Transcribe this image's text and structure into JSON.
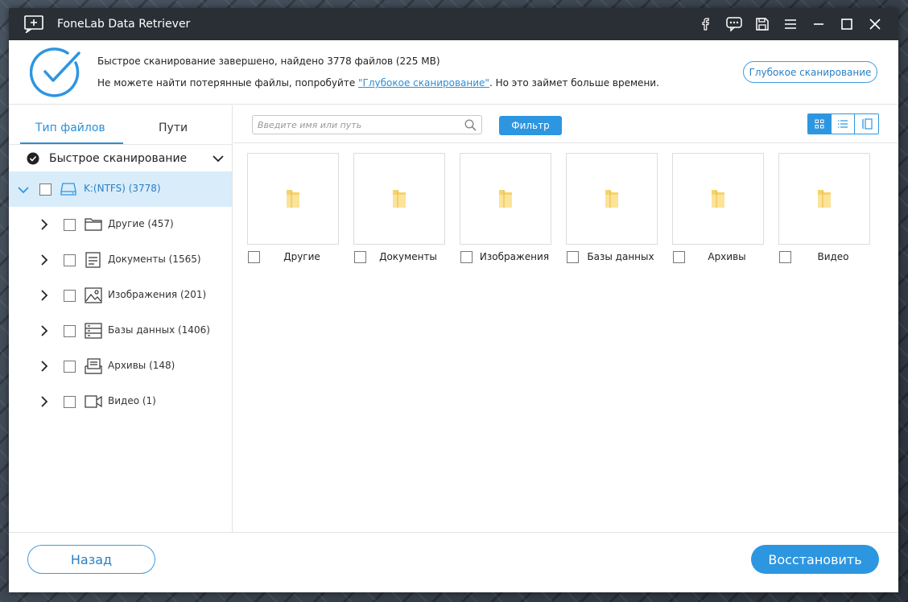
{
  "window": {
    "title": "FoneLab Data Retriever"
  },
  "status": {
    "line1": "Быстрое сканирование завершено, найдено 3778 файлов (225 MB)",
    "line2_prefix": "Не можете найти потерянные файлы, попробуйте ",
    "line2_link": "\"Глубокое сканирование\"",
    "line2_suffix": ". Но это займет больше времени.",
    "deep_scan_button": "Глубокое сканирование"
  },
  "sidebar": {
    "tabs": [
      {
        "label": "Тип файлов",
        "active": true
      },
      {
        "label": "Пути",
        "active": false
      }
    ],
    "scan_mode": "Быстрое сканирование",
    "drive": "K:(NTFS) (3778)",
    "items": [
      {
        "label": "Другие (457)",
        "icon": "folder-icon"
      },
      {
        "label": "Документы (1565)",
        "icon": "document-icon"
      },
      {
        "label": "Изображения (201)",
        "icon": "image-icon"
      },
      {
        "label": "Базы данных (1406)",
        "icon": "database-icon"
      },
      {
        "label": "Архивы (148)",
        "icon": "archive-icon"
      },
      {
        "label": "Видео (1)",
        "icon": "video-icon"
      }
    ]
  },
  "toolbar": {
    "search_placeholder": "Введите имя или путь",
    "filter_label": "Фильтр",
    "view_modes": [
      "grid-view-icon",
      "list-view-icon",
      "column-view-icon"
    ],
    "active_view": "grid-view-icon"
  },
  "grid": {
    "folders": [
      {
        "name": "Другие"
      },
      {
        "name": "Документы"
      },
      {
        "name": "Изображения"
      },
      {
        "name": "Базы данных"
      },
      {
        "name": "Архивы"
      },
      {
        "name": "Видео"
      }
    ]
  },
  "footer": {
    "back_label": "Назад",
    "recover_label": "Восстановить"
  },
  "colors": {
    "accent": "#2d96e1",
    "titlebar": "#2a2f35",
    "selected_row": "#d9ecfa",
    "folder": "#f6d36b"
  }
}
